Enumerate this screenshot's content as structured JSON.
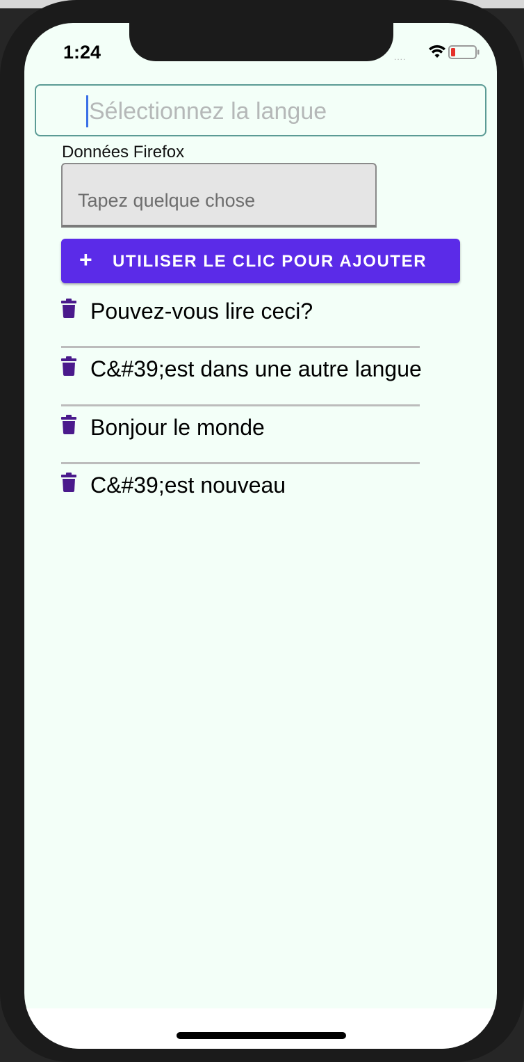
{
  "status_bar": {
    "time": "1:24",
    "signal_dots": "....",
    "signal_icon": "signal-dots-icon",
    "wifi_icon": "wifi-icon",
    "battery_icon": "battery-low-icon"
  },
  "language_select": {
    "placeholder": "Sélectionnez la langue"
  },
  "data_field": {
    "label": "Données Firefox",
    "placeholder": "Tapez quelque chose"
  },
  "add_button": {
    "icon": "plus-icon",
    "plus_glyph": "+",
    "label": "UTILISER LE CLIC POUR AJOUTER"
  },
  "items": [
    {
      "text": "Pouvez-vous lire ceci?",
      "icon": "trash-icon"
    },
    {
      "text": "C&#39;est dans une autre langue",
      "icon": "trash-icon"
    },
    {
      "text": "Bonjour le monde",
      "icon": "trash-icon"
    },
    {
      "text": "C&#39;est nouveau",
      "icon": "trash-icon"
    }
  ],
  "colors": {
    "screen_background": "#f3fff8",
    "button_background": "#5b2be8",
    "trash_icon": "#4a1a8c",
    "input_border": "#5b9b95",
    "caret": "#3a6fe6"
  }
}
